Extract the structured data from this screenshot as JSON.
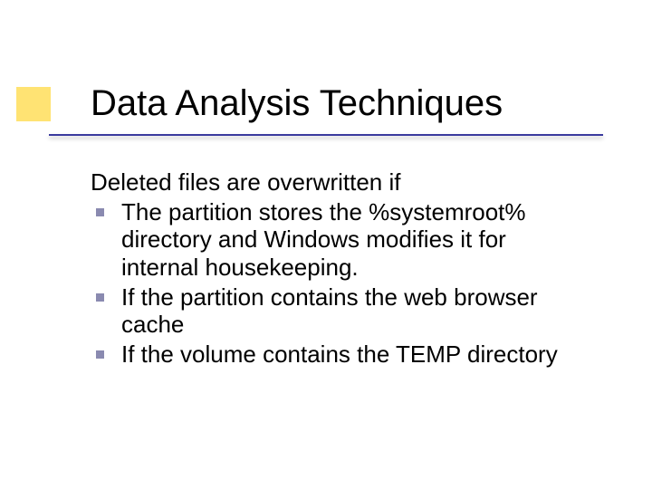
{
  "title": "Data Analysis Techniques",
  "lead": "Deleted files are overwritten if",
  "bullets": {
    "b0": "The partition stores the %systemroot% directory and Windows modifies it for internal housekeeping.",
    "b1": "If the partition contains the web browser cache",
    "b2": "If the volume contains the TEMP directory"
  }
}
